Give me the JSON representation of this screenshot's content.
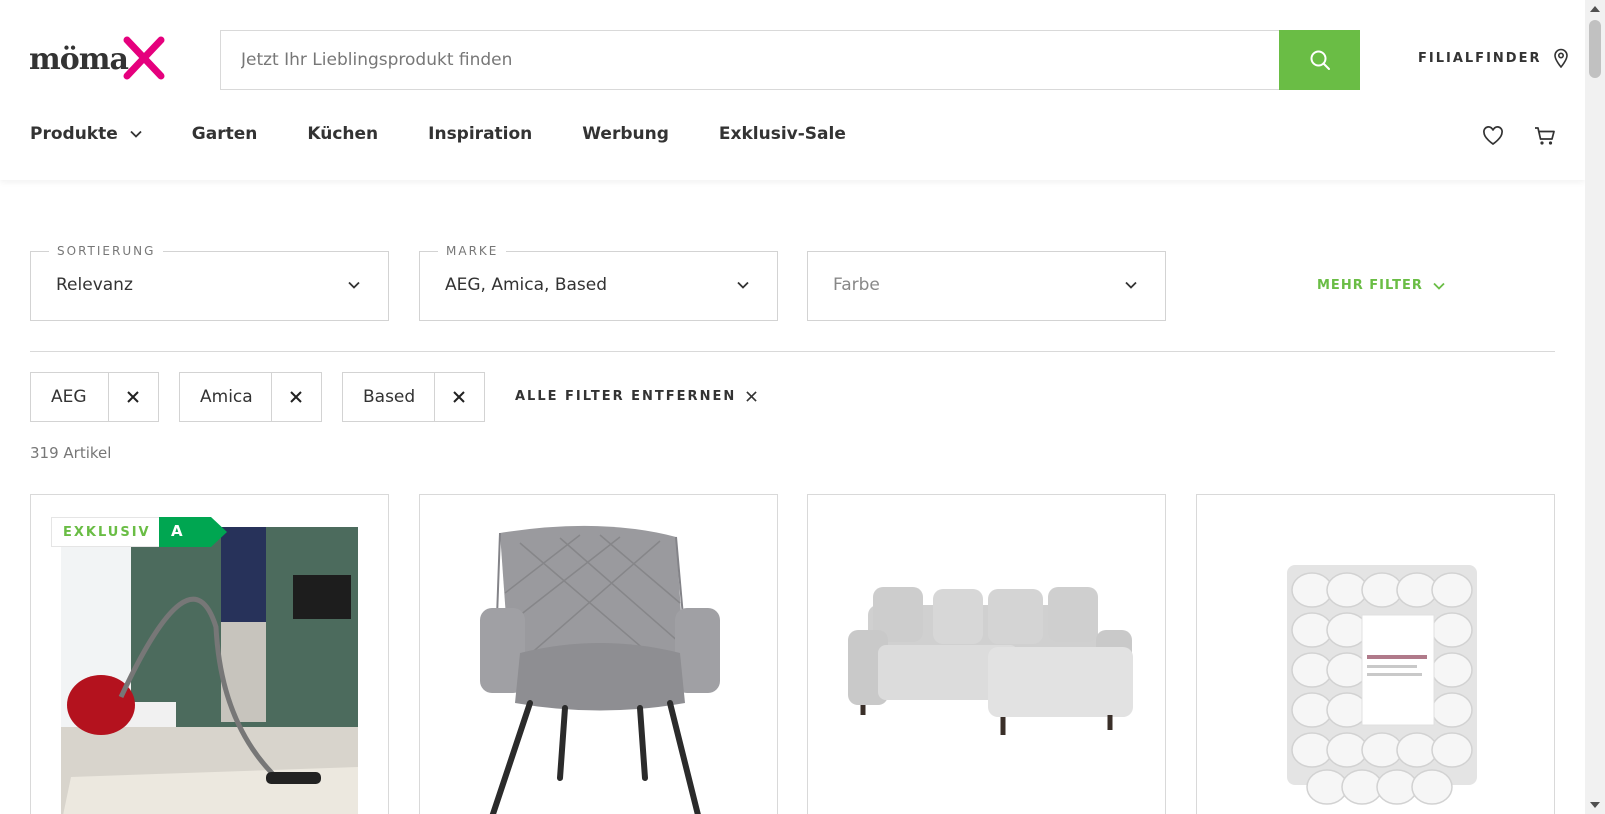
{
  "header": {
    "logo_text": "möma",
    "search_placeholder": "Jetzt Ihr Lieblingsprodukt finden",
    "filialfinder_label": "FILIALFINDER",
    "accent_color": "#6abd45",
    "brand_color": "#e5007d"
  },
  "nav": {
    "items": [
      {
        "label": "Produkte",
        "has_dropdown": true
      },
      {
        "label": "Garten"
      },
      {
        "label": "Küchen"
      },
      {
        "label": "Inspiration"
      },
      {
        "label": "Werbung"
      },
      {
        "label": "Exklusiv-Sale"
      }
    ],
    "icons": [
      "heart-icon",
      "cart-icon"
    ]
  },
  "filters": {
    "sort": {
      "legend": "SORTIERUNG",
      "value": "Relevanz"
    },
    "brand": {
      "legend": "MARKE",
      "value": "AEG, Amica, Based"
    },
    "color": {
      "placeholder": "Farbe"
    },
    "more_label": "MEHR FILTER"
  },
  "active_filters": {
    "chips": [
      "AEG",
      "Amica",
      "Based"
    ],
    "clear_all_label": "ALLE FILTER ENTFERNEN"
  },
  "results": {
    "count_label": "319 Artikel"
  },
  "products": [
    {
      "image": "vacuum-cleaner-image",
      "badge_exklusiv": "EXKLUSIV",
      "energy_label": "A",
      "energy_color": "#00a651"
    },
    {
      "image": "upholstered-chair-image"
    },
    {
      "image": "corner-sofa-image"
    },
    {
      "image": "tealight-candles-image"
    }
  ]
}
